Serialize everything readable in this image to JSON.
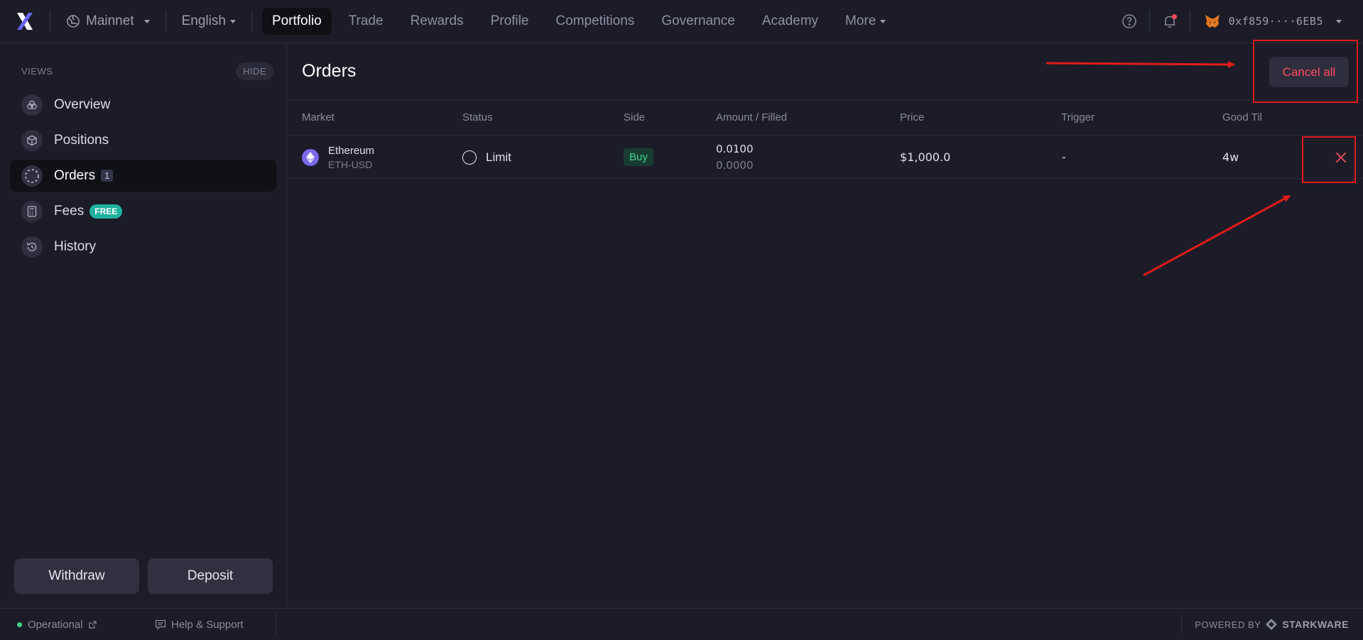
{
  "topbar": {
    "network": "Mainnet",
    "language": "English",
    "nav": [
      "Portfolio",
      "Trade",
      "Rewards",
      "Profile",
      "Competitions",
      "Governance",
      "Academy",
      "More"
    ],
    "wallet_address": "0xf859····6EB5"
  },
  "sidebar": {
    "views_label": "VIEWS",
    "hide_label": "HIDE",
    "items": [
      {
        "label": "Overview",
        "icon": "overview-icon"
      },
      {
        "label": "Positions",
        "icon": "cube-icon"
      },
      {
        "label": "Orders",
        "icon": "dashed-circle-icon",
        "count": "1"
      },
      {
        "label": "Fees",
        "icon": "calculator-icon",
        "badge": "FREE"
      },
      {
        "label": "History",
        "icon": "history-icon"
      }
    ],
    "withdraw_label": "Withdraw",
    "deposit_label": "Deposit"
  },
  "main": {
    "title": "Orders",
    "cancel_all_label": "Cancel all",
    "columns": [
      "Market",
      "Status",
      "Side",
      "Amount / Filled",
      "Price",
      "Trigger",
      "Good Til"
    ],
    "rows": [
      {
        "market_name": "Ethereum",
        "market_symbol": "ETH-USD",
        "status": "Limit",
        "side": "Buy",
        "amount": "0.0100",
        "filled": "0.0000",
        "price": "$1,000.0",
        "trigger": "-",
        "good_til": "4w"
      }
    ]
  },
  "footer": {
    "status": "Operational",
    "help": "Help & Support",
    "powered_by": "POWERED BY",
    "brand": "STARKWARE"
  },
  "colors": {
    "background": "#1c1c28",
    "accent_red": "#ff4b5c",
    "buy_green": "#3fd18e",
    "free_badge": "#20b2a0",
    "annotation_red": "#e11b1b"
  }
}
